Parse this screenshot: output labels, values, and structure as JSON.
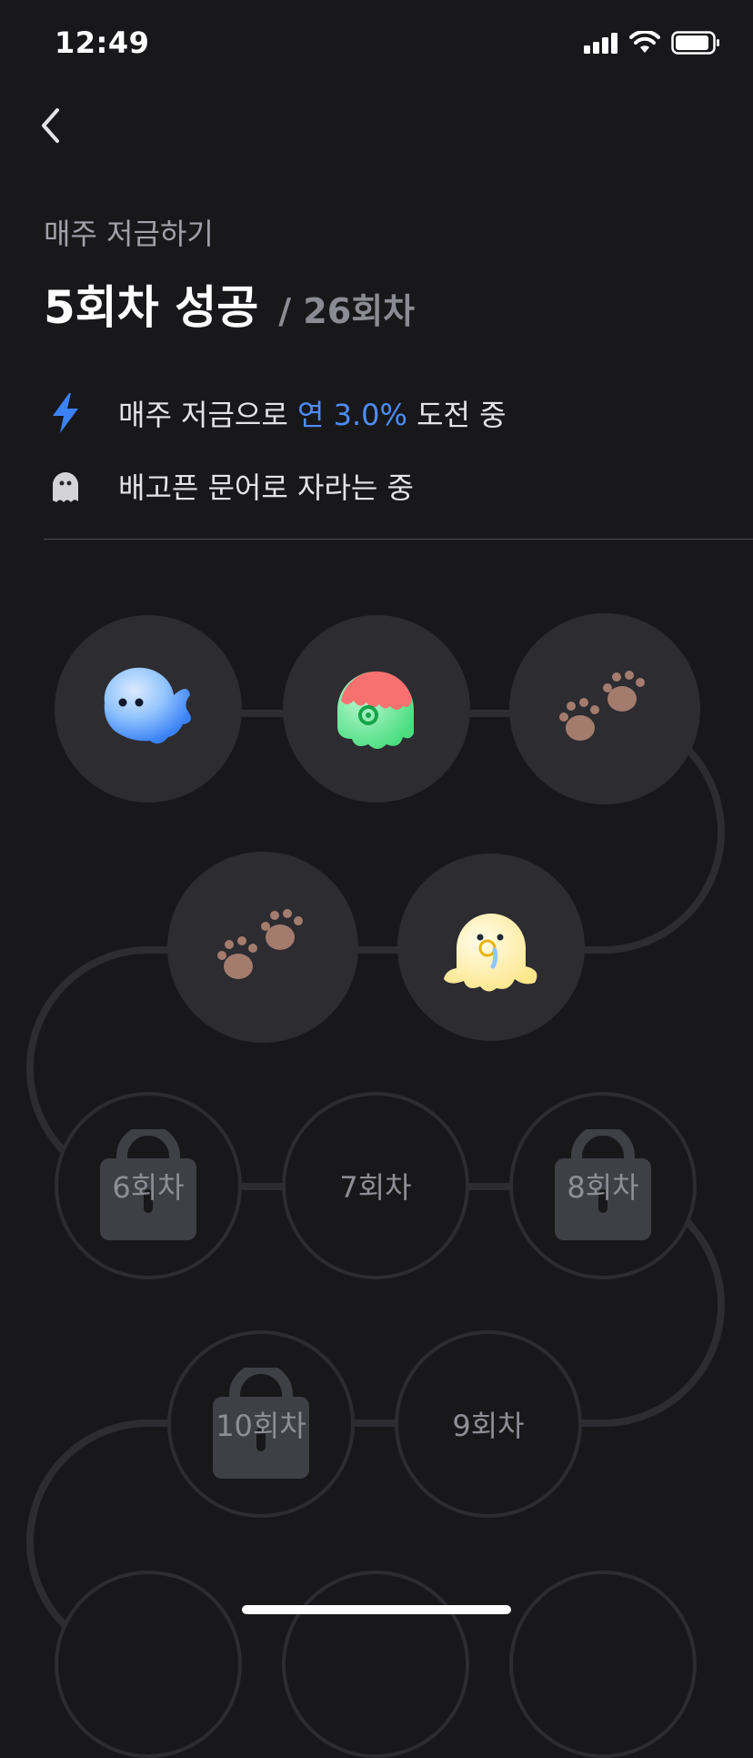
{
  "status_bar": {
    "time": "12:49"
  },
  "header": {
    "subtitle": "매주 저금하기",
    "title": "5회차 성공",
    "total": "/ 26회차"
  },
  "info": [
    {
      "icon": "lightning-icon",
      "prefix": "매주 저금으로 ",
      "highlight": "연 3.0%",
      "suffix": " 도전 중"
    },
    {
      "icon": "ghost-octopus-icon",
      "text": "배고픈 문어로 자라는 중"
    }
  ],
  "path": {
    "nodes": [
      {
        "id": 1,
        "state": "done",
        "icon": "blue-octopus-icon"
      },
      {
        "id": 2,
        "state": "done",
        "icon": "green-octopus-icon"
      },
      {
        "id": 3,
        "state": "done",
        "icon": "paw-prints-icon"
      },
      {
        "id": 4,
        "state": "done",
        "icon": "yellow-octopus-icon"
      },
      {
        "id": 5,
        "state": "done",
        "icon": "paw-prints-icon"
      },
      {
        "id": 6,
        "state": "locked",
        "label": "6회차"
      },
      {
        "id": 7,
        "state": "open",
        "label": "7회차"
      },
      {
        "id": 8,
        "state": "locked",
        "label": "8회차"
      },
      {
        "id": 9,
        "state": "open",
        "label": "9회차"
      },
      {
        "id": 10,
        "state": "locked",
        "label": "10회차"
      }
    ]
  },
  "colors": {
    "background": "#18181b",
    "node": "#2c2c31",
    "accent": "#4d8ef7"
  }
}
